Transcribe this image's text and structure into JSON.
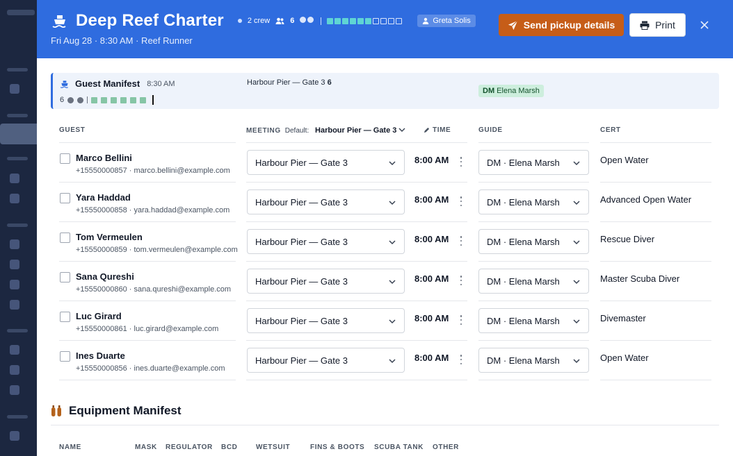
{
  "header": {
    "title": "Deep Reef Charter",
    "crew": "2 crew",
    "guest_count": "6",
    "user": "Greta Solis",
    "subtitle": "Fri Aug 28 · 8:30 AM · Reef Runner",
    "send_label": "Send pickup details",
    "print_label": "Print",
    "colors": {
      "header_bg": "#2f6cdf",
      "send_bg": "#c65d18",
      "capacity_fill": "#5fd4d4"
    },
    "capacity": {
      "filled": 6,
      "total": 10
    }
  },
  "summary": {
    "title": "Guest Manifest",
    "time": "8:30 AM",
    "count": "6",
    "meeting_text": "Harbour Pier — Gate 3",
    "meeting_count": "6",
    "guide_badge": "DM",
    "guide_name": "Elena Marsh"
  },
  "columns": {
    "guest": "GUEST",
    "meeting": "MEETING",
    "default_label": "Default:",
    "default_value": "Harbour Pier — Gate 3",
    "time": "TIME",
    "guide": "GUIDE",
    "cert": "CERT"
  },
  "guests": [
    {
      "name": "Marco Bellini",
      "contact": "+15550000857 · marco.bellini@example.com",
      "meeting": "Harbour Pier — Gate 3",
      "time": "8:00 AM",
      "guide": "DM · Elena Marsh",
      "cert": "Open Water"
    },
    {
      "name": "Yara Haddad",
      "contact": "+15550000858 · yara.haddad@example.com",
      "meeting": "Harbour Pier — Gate 3",
      "time": "8:00 AM",
      "guide": "DM · Elena Marsh",
      "cert": "Advanced Open Water"
    },
    {
      "name": "Tom Vermeulen",
      "contact": "+15550000859 · tom.vermeulen@example.com",
      "meeting": "Harbour Pier — Gate 3",
      "time": "8:00 AM",
      "guide": "DM · Elena Marsh",
      "cert": "Rescue Diver"
    },
    {
      "name": "Sana Qureshi",
      "contact": "+15550000860 · sana.qureshi@example.com",
      "meeting": "Harbour Pier — Gate 3",
      "time": "8:00 AM",
      "guide": "DM · Elena Marsh",
      "cert": "Master Scuba Diver"
    },
    {
      "name": "Luc Girard",
      "contact": "+15550000861 · luc.girard@example.com",
      "meeting": "Harbour Pier — Gate 3",
      "time": "8:00 AM",
      "guide": "DM · Elena Marsh",
      "cert": "Divemaster"
    },
    {
      "name": "Ines Duarte",
      "contact": "+15550000856 · ines.duarte@example.com",
      "meeting": "Harbour Pier — Gate 3",
      "time": "8:00 AM",
      "guide": "DM · Elena Marsh",
      "cert": "Open Water"
    }
  ],
  "equipment": {
    "title": "Equipment Manifest",
    "columns": [
      "NAME",
      "MASK",
      "REGULATOR",
      "BCD",
      "WETSUIT",
      "FINS & BOOTS",
      "SCUBA TANK",
      "OTHER"
    ]
  }
}
